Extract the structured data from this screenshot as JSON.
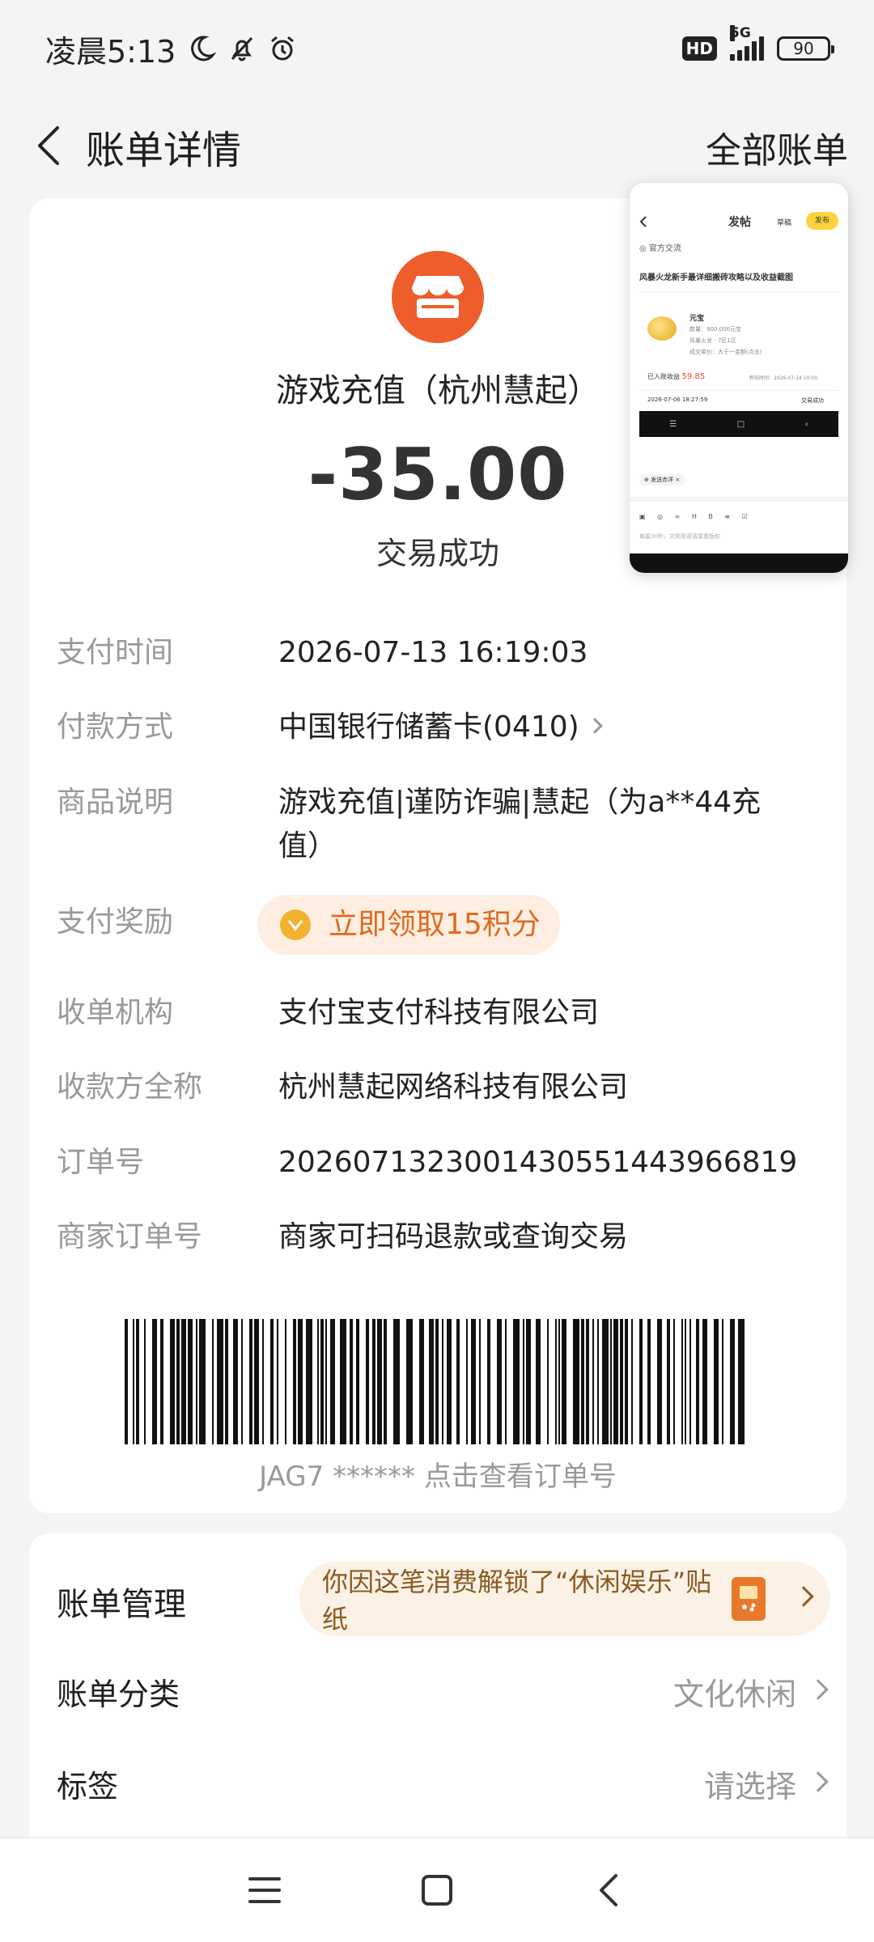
{
  "status_bar": {
    "time": "凌晨5:13",
    "hd": "HD",
    "network": "5G",
    "battery": "90"
  },
  "header": {
    "title": "账单详情",
    "all_bills": "全部账单"
  },
  "transaction": {
    "merchant": "游戏充值（杭州慧起）",
    "amount": "-35.00",
    "status": "交易成功"
  },
  "details": [
    {
      "label": "支付时间",
      "value": "2026-07-13 16:19:03"
    },
    {
      "label": "付款方式",
      "value": "中国银行储蓄卡(0410)"
    },
    {
      "label": "商品说明",
      "value": "游戏充值|谨防诈骗|慧起（为a**44充值）"
    },
    {
      "label": "支付奖励",
      "value": "立即领取15积分"
    },
    {
      "label": "收单机构",
      "value": "支付宝支付科技有限公司"
    },
    {
      "label": "收款方全称",
      "value": "杭州慧起网络科技有限公司"
    },
    {
      "label": "订单号",
      "value": "2026071323001430551443966819"
    },
    {
      "label": "商家订单号",
      "value": "商家可扫码退款或查询交易"
    }
  ],
  "barcode": {
    "caption": "JAG7 ****** 点击查看订单号"
  },
  "overlay": {
    "top_title": "发帖",
    "draft": "草稿",
    "publish": "发布",
    "section": "官方交流",
    "post_title": "风暴火龙新手最详细搬砖攻略以及收益截图",
    "item_name": "元宝",
    "item_line1": "数量：900,000元宝",
    "item_line2": "风暴火龙 - 7区1区",
    "item_line3": "成交单价：大于一金额(点击)",
    "earned_label": "已入账收益",
    "earned_value": "59.85",
    "earned_date": "新帖时间：2026-07-14 10:00",
    "row_date": "2026-07-06 18:27:59",
    "row_status": "交易成功",
    "tag": "发送赤洋",
    "hint": "每篇30秒，文明用语请尊重版权"
  },
  "manage": {
    "title": "账单管理",
    "sticker": "你因这笔消费解锁了“休闲娱乐”贴纸",
    "category_label": "账单分类",
    "category_value": "文化休闲",
    "tag_label": "标签",
    "tag_value": "请选择"
  }
}
